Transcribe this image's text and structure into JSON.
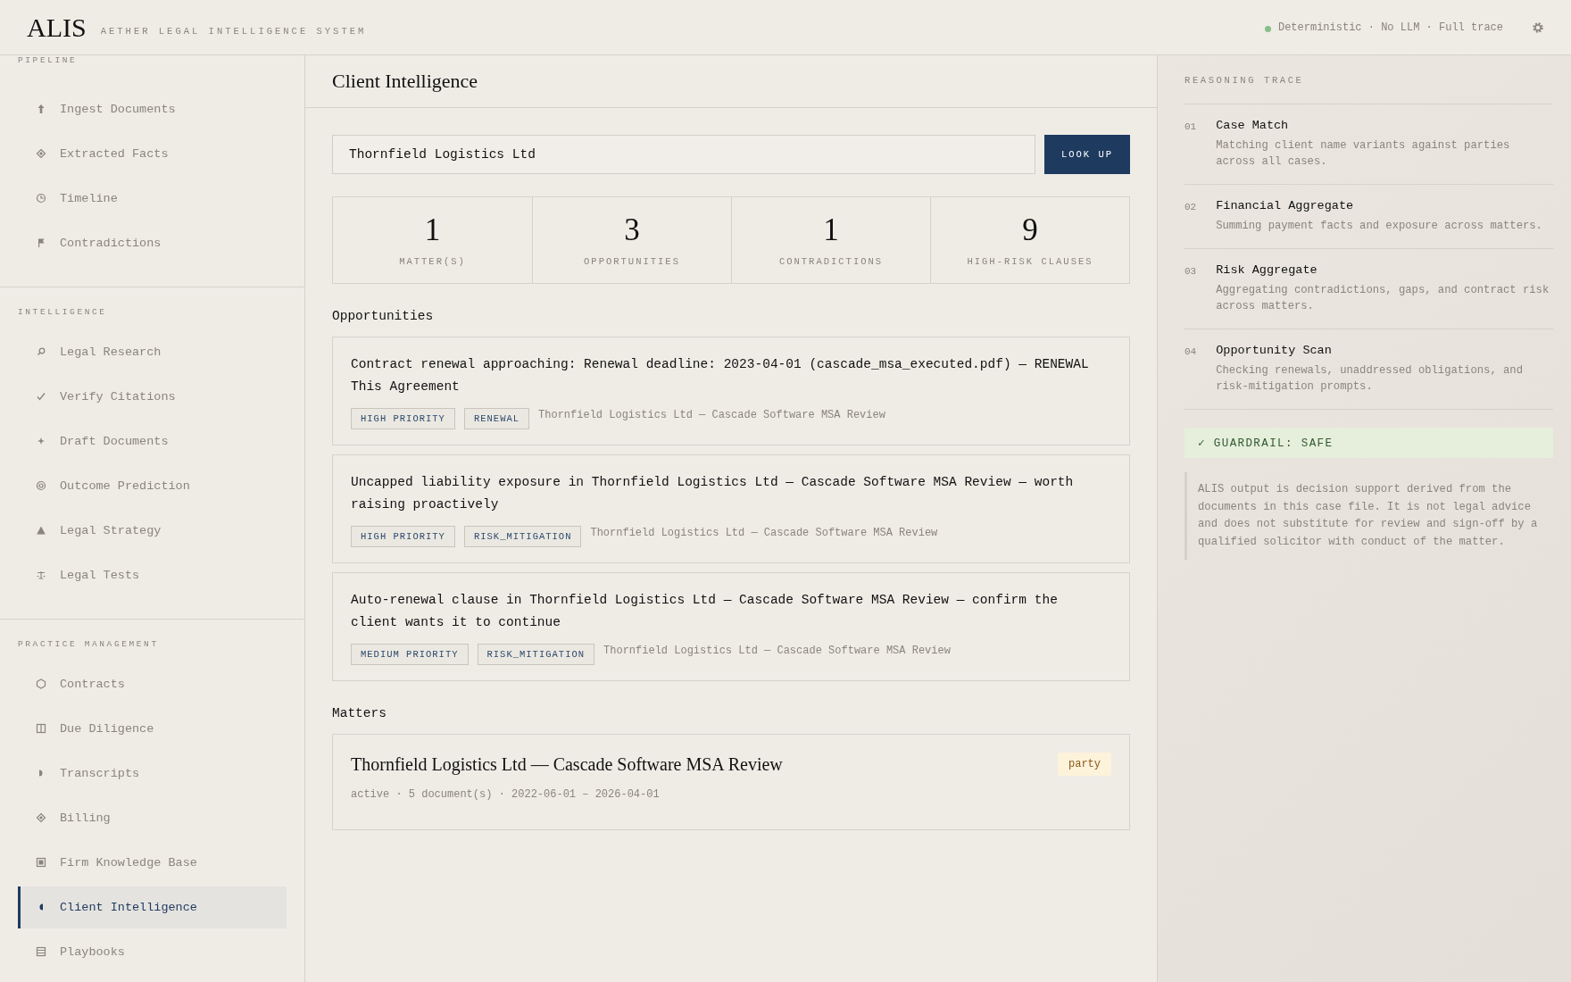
{
  "header": {
    "logo": "ALIS",
    "subtitle": "AETHER LEGAL INTELLIGENCE SYSTEM",
    "status": "Deterministic · No LLM · Full trace"
  },
  "sidebar": {
    "sections": [
      {
        "title": "PIPELINE",
        "items": [
          {
            "label": "Ingest Documents",
            "selected": false
          },
          {
            "label": "Extracted Facts",
            "selected": false
          },
          {
            "label": "Timeline",
            "selected": false
          },
          {
            "label": "Contradictions",
            "selected": false
          }
        ]
      },
      {
        "title": "INTELLIGENCE",
        "items": [
          {
            "label": "Legal Research",
            "selected": false
          },
          {
            "label": "Verify Citations",
            "selected": false
          },
          {
            "label": "Draft Documents",
            "selected": false
          },
          {
            "label": "Outcome Prediction",
            "selected": false
          },
          {
            "label": "Legal Strategy",
            "selected": false
          },
          {
            "label": "Legal Tests",
            "selected": false
          }
        ]
      },
      {
        "title": "PRACTICE MANAGEMENT",
        "items": [
          {
            "label": "Contracts",
            "selected": false
          },
          {
            "label": "Due Diligence",
            "selected": false
          },
          {
            "label": "Transcripts",
            "selected": false
          },
          {
            "label": "Billing",
            "selected": false
          },
          {
            "label": "Firm Knowledge Base",
            "selected": false
          },
          {
            "label": "Client Intelligence",
            "selected": true
          },
          {
            "label": "Playbooks",
            "selected": false
          }
        ]
      }
    ]
  },
  "page_title": "Client Intelligence",
  "search": {
    "value": "Thornfield Logistics Ltd",
    "button": "LOOK UP"
  },
  "stats": [
    {
      "value": "1",
      "label": "MATTER(S)"
    },
    {
      "value": "3",
      "label": "OPPORTUNITIES"
    },
    {
      "value": "1",
      "label": "CONTRADICTIONS"
    },
    {
      "value": "9",
      "label": "HIGH-RISK CLAUSES"
    }
  ],
  "opportunities": {
    "heading": "Opportunities",
    "items": [
      {
        "text": "Contract renewal approaching: Renewal deadline: 2023-04-01 (cascade_msa_executed.pdf) — RENEWAL This Agreement",
        "tags": [
          "HIGH PRIORITY",
          "RENEWAL"
        ],
        "source": "Thornfield Logistics Ltd — Cascade Software MSA Review"
      },
      {
        "text": "Uncapped liability exposure in Thornfield Logistics Ltd — Cascade Software MSA Review — worth raising proactively",
        "tags": [
          "HIGH PRIORITY",
          "RISK_MITIGATION"
        ],
        "source": "Thornfield Logistics Ltd — Cascade Software MSA Review"
      },
      {
        "text": "Auto-renewal clause in Thornfield Logistics Ltd — Cascade Software MSA Review — confirm the client wants it to continue",
        "tags": [
          "MEDIUM PRIORITY",
          "RISK_MITIGATION"
        ],
        "source": "Thornfield Logistics Ltd — Cascade Software MSA Review"
      }
    ]
  },
  "matters": {
    "heading": "Matters",
    "items": [
      {
        "title": "Thornfield Logistics Ltd — Cascade Software MSA Review",
        "badge": "party",
        "meta": "active · 5 document(s) · 2022-06-01 – 2026-04-01"
      }
    ]
  },
  "trace": {
    "title": "REASONING TRACE",
    "steps": [
      {
        "number": "01",
        "title": "Case Match",
        "text": "Matching client name variants against parties across all cases."
      },
      {
        "number": "02",
        "title": "Financial Aggregate",
        "text": "Summing payment facts and exposure across matters."
      },
      {
        "number": "03",
        "title": "Risk Aggregate",
        "text": "Aggregating contradictions, gaps, and contract risk across matters."
      },
      {
        "number": "04",
        "title": "Opportunity Scan",
        "text": "Checking renewals, unaddressed obligations, and risk-mitigation prompts."
      }
    ],
    "guardrail": "✓ GUARDRAIL: SAFE",
    "disclaimer": "ALIS output is decision support derived from the documents in this case file. It is not legal advice and does not substitute for review and sign-off by a qualified solicitor with conduct of the matter."
  }
}
